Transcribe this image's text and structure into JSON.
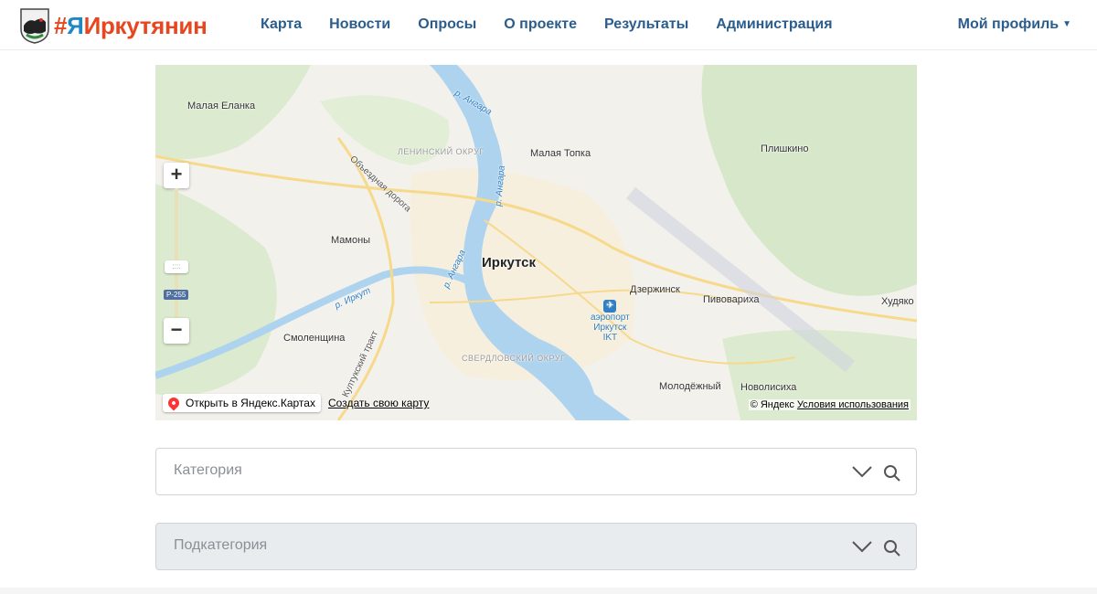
{
  "header": {
    "brand": {
      "hash": "#",
      "ya": "Я",
      "rest": "Иркутянин"
    },
    "nav": [
      "Карта",
      "Новости",
      "Опросы",
      "О проекте",
      "Результаты",
      "Администрация"
    ],
    "profile": "Мой профиль"
  },
  "map": {
    "labels": {
      "malaya_elanka": "Малая Еланка",
      "malaya_topka": "Малая Топка",
      "plishkino": "Плишкино",
      "leninsky": "ЛЕНИНСКИЙ ОКРУГ",
      "obezdnaya": "Объездная дорога",
      "river_angara1": "р. Ангара",
      "river_angara2": "р. Ангара",
      "river_angara3": "р. Ангара",
      "mamony": "Мамоны",
      "irkutsk": "Иркутск",
      "river_irkut": "р. Иркут",
      "dzerzhinsk": "Дзержинск",
      "pivovarikha": "Пивовариха",
      "khudyakovo": "Худяко",
      "smolenshchina": "Смоленщина",
      "kultuk_trakt": "Култукский тракт",
      "sverdlovsky": "СВЕРДЛОВСКИЙ ОКРУГ",
      "molodyozhny": "Молодёжный",
      "novolisikha": "Новолисиха",
      "road_sign": "Р-255"
    },
    "airport": {
      "line1": "аэропорт",
      "line2": "Иркутск",
      "line3": "IKT"
    },
    "zoom_in": "+",
    "zoom_out": "−",
    "open_yandex": "Открыть в Яндекс.Картах",
    "create_map": "Создать свою карту",
    "copyright": "© Яндекс",
    "terms": "Условия использования"
  },
  "category": {
    "placeholder": "Категория"
  },
  "subcategory": {
    "placeholder": "Подкатегория"
  }
}
